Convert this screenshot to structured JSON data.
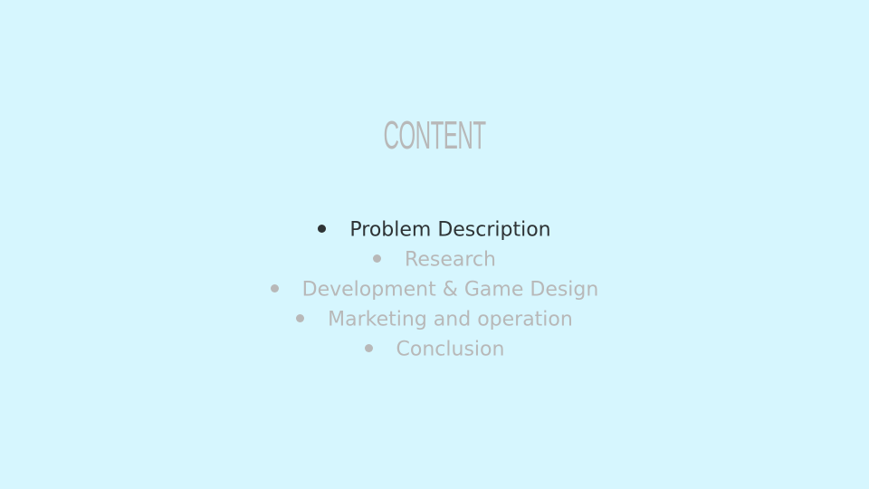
{
  "slide": {
    "title": "CONTENT",
    "background": "#d6f6fe",
    "active_color": "#2e3335",
    "inactive_color": "#b8b8b8",
    "items": [
      {
        "label": "Problem Description",
        "active": true
      },
      {
        "label": "Research",
        "active": false
      },
      {
        "label": "Development & Game Design",
        "active": false
      },
      {
        "label": "Marketing and operation",
        "active": false
      },
      {
        "label": "Conclusion",
        "active": false
      }
    ]
  }
}
